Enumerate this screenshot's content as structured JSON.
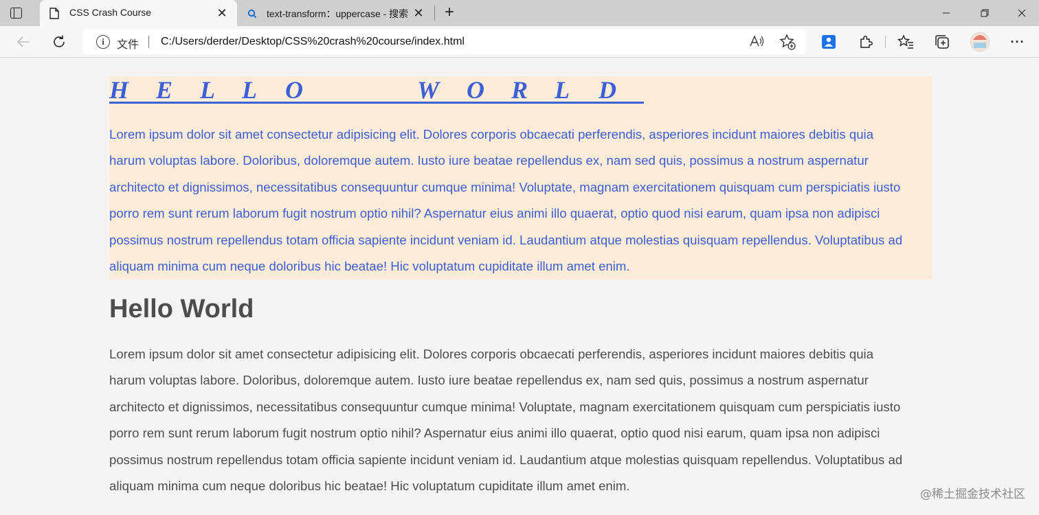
{
  "tabs": [
    {
      "title": "CSS Crash Course",
      "active": true
    },
    {
      "title": "text-transform：uppercase - 搜索",
      "active": false
    }
  ],
  "window": {
    "minimize": "—",
    "restore": "❐",
    "close": "✕"
  },
  "address_bar": {
    "file_label": "文件",
    "url": "C:/Users/derder/Desktop/CSS%20crash%20course/index.html"
  },
  "icons": {
    "close_tab": "✕",
    "new_tab": "+",
    "back": "←",
    "refresh": "↻",
    "read_aloud": "A",
    "more": "···"
  },
  "page": {
    "fancy_heading": "H   E   L   L   O         W   O   R   L   D   ",
    "fancy_heading_letters": [
      "H",
      "E",
      "L",
      "L",
      "O",
      "W",
      "O",
      "R",
      "L",
      "D"
    ],
    "paragraph": "Lorem ipsum dolor sit amet consectetur adipisicing elit. Dolores corporis obcaecati perferendis, asperiores incidunt maiores debitis quia harum voluptas labore. Doloribus, doloremque autem. Iusto iure beatae repellendus ex, nam sed quis, possimus a nostrum aspernatur architecto et dignissimos, necessitatibus consequuntur cumque minima! Voluptate, magnam exercitationem quisquam cum perspiciatis iusto porro rem sunt rerum laborum fugit nostrum optio nihil? Aspernatur eius animi illo quaerat, optio quod nisi earum, quam ipsa non adipisci possimus nostrum repellendus totam officia sapiente incidunt veniam id. Laudantium atque molestias quisquam repellendus. Voluptatibus ad aliquam minima cum neque doloribus hic beatae! Hic voluptatum cupiditate illum amet enim.",
    "paragraph_lines": [
      "Lorem ipsum dolor sit amet consectetur adipisicing elit. Dolores corporis obcaecati perferendis, asperiores incidunt maiores debitis quia",
      "harum voluptas labore. Doloribus, doloremque autem. Iusto iure beatae repellendus ex, nam sed quis, possimus a nostrum aspernatur",
      "architecto et dignissimos, necessitatibus consequuntur cumque minima! Voluptate, magnam exercitationem quisquam cum perspiciatis iusto",
      "porro rem sunt rerum laborum fugit nostrum optio nihil? Aspernatur eius animi illo quaerat, optio quod nisi earum, quam ipsa non adipisci",
      "possimus nostrum repellendus totam officia sapiente incidunt veniam id. Laudantium atque molestias quisquam repellendus. Voluptatibus ad",
      "aliquam minima cum neque doloribus hic beatae! Hic voluptatum cupiditate illum amet enim."
    ],
    "heading": "Hello World"
  },
  "watermark": "@稀土掘金技术社区",
  "colors": {
    "link_blue": "#3c5fd8",
    "box_bg": "#fbebd9",
    "text_gray": "#4d4d4d",
    "page_bg": "#f4f4f4"
  }
}
